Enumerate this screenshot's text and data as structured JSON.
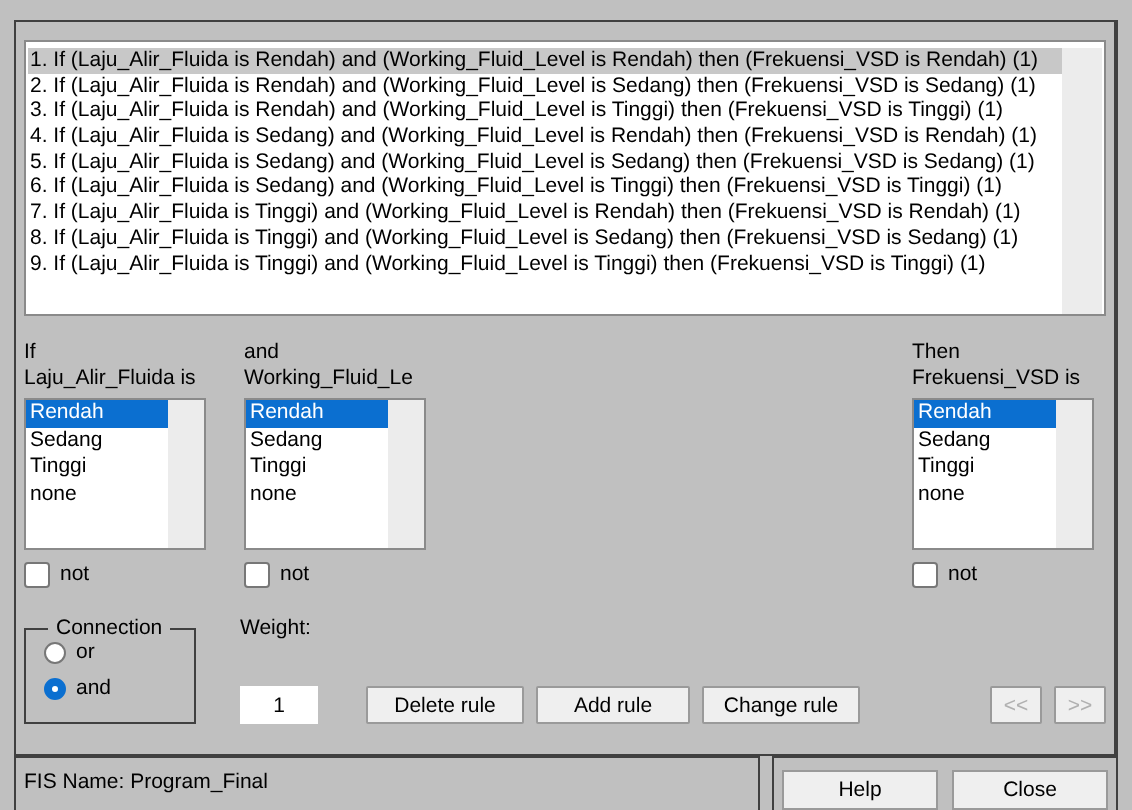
{
  "rules": [
    {
      "text": "1. If (Laju_Alir_Fluida is Rendah) and (Working_Fluid_Level is Rendah) then (Frekuensi_VSD is Rendah) (1)",
      "selected": true
    },
    {
      "text": "2. If (Laju_Alir_Fluida is Rendah) and (Working_Fluid_Level is Sedang) then (Frekuensi_VSD is Sedang) (1)",
      "selected": false
    },
    {
      "text": "3. If (Laju_Alir_Fluida is Rendah) and (Working_Fluid_Level is Tinggi) then (Frekuensi_VSD is Tinggi) (1)",
      "selected": false
    },
    {
      "text": "4. If (Laju_Alir_Fluida is Sedang) and (Working_Fluid_Level is Rendah) then (Frekuensi_VSD is Rendah) (1)",
      "selected": false
    },
    {
      "text": "5. If (Laju_Alir_Fluida is Sedang) and (Working_Fluid_Level is Sedang) then (Frekuensi_VSD is Sedang) (1)",
      "selected": false
    },
    {
      "text": "6. If (Laju_Alir_Fluida is Sedang) and (Working_Fluid_Level is Tinggi) then (Frekuensi_VSD is Tinggi) (1)",
      "selected": false
    },
    {
      "text": "7. If (Laju_Alir_Fluida is Tinggi) and (Working_Fluid_Level is Rendah) then (Frekuensi_VSD is Rendah) (1)",
      "selected": false
    },
    {
      "text": "8. If (Laju_Alir_Fluida is Tinggi) and (Working_Fluid_Level is Sedang) then (Frekuensi_VSD is Sedang) (1)",
      "selected": false
    },
    {
      "text": "9. If (Laju_Alir_Fluida is Tinggi) and (Working_Fluid_Level is Tinggi) then (Frekuensi_VSD is Tinggi) (1)",
      "selected": false
    }
  ],
  "columns": [
    {
      "kind": "input",
      "heading": "If",
      "variable": "Laju_Alir_Fluida is",
      "not_label": "not",
      "not_checked": false,
      "items": [
        {
          "label": "Rendah",
          "selected": true
        },
        {
          "label": "Sedang",
          "selected": false
        },
        {
          "label": "Tinggi",
          "selected": false
        },
        {
          "label": "none",
          "selected": false
        }
      ]
    },
    {
      "kind": "input",
      "heading": "and",
      "variable": "Working_Fluid_Le",
      "not_label": "not",
      "not_checked": false,
      "items": [
        {
          "label": "Rendah",
          "selected": true
        },
        {
          "label": "Sedang",
          "selected": false
        },
        {
          "label": "Tinggi",
          "selected": false
        },
        {
          "label": "none",
          "selected": false
        }
      ]
    },
    {
      "kind": "output",
      "heading": "Then",
      "variable": "Frekuensi_VSD is",
      "not_label": "not",
      "not_checked": false,
      "items": [
        {
          "label": "Rendah",
          "selected": true
        },
        {
          "label": "Sedang",
          "selected": false
        },
        {
          "label": "Tinggi",
          "selected": false
        },
        {
          "label": "none",
          "selected": false
        }
      ]
    }
  ],
  "connection": {
    "title": "Connection",
    "options": [
      {
        "label": "or",
        "selected": false
      },
      {
        "label": "and",
        "selected": true
      }
    ]
  },
  "weight": {
    "label": "Weight:",
    "value": "1"
  },
  "rule_buttons": [
    {
      "label": "Delete rule",
      "disabled": false
    },
    {
      "label": "Add rule",
      "disabled": false
    },
    {
      "label": "Change rule",
      "disabled": false
    }
  ],
  "nav_buttons": [
    {
      "label": "<<",
      "disabled": true
    },
    {
      "label": ">>",
      "disabled": true
    }
  ],
  "status": "FIS Name: Program_Final",
  "footer_buttons": [
    "Help",
    "Close"
  ]
}
